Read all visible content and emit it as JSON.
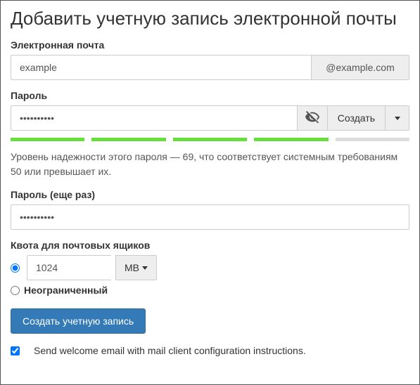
{
  "title": "Добавить учетную запись электронной почты",
  "email": {
    "label": "Электронная почта",
    "value": "example",
    "domain": "@example.com"
  },
  "password": {
    "label": "Пароль",
    "value": "••••••••••",
    "generate_label": "Создать",
    "strength_score": 69,
    "strength_min": 50,
    "strength_text": "Уровень надежности этого пароля — 69, что соответствует системным требованиям 50 или превышает их."
  },
  "password_confirm": {
    "label": "Пароль (еще раз)",
    "value": "••••••••••"
  },
  "quota": {
    "label": "Квота для почтовых ящиков",
    "value": "1024",
    "unit": "MB",
    "unlimited_label": "Неограниченный"
  },
  "submit_label": "Создать учетную запись",
  "welcome_label": "Send welcome email with mail client configuration instructions."
}
